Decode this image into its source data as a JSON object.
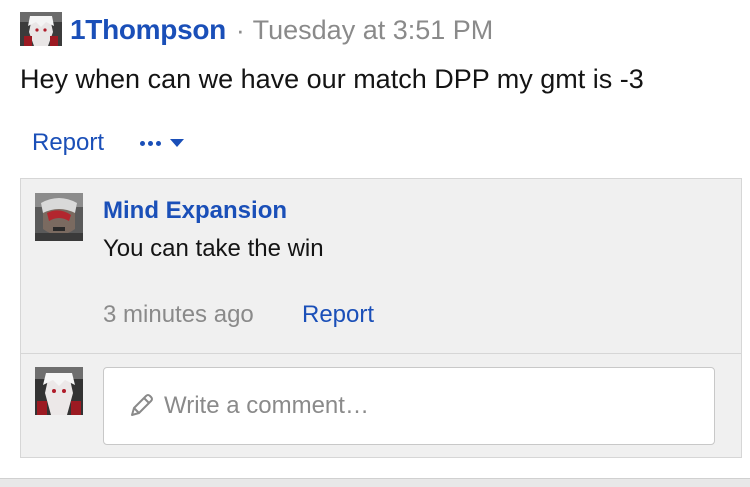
{
  "post": {
    "author": "1Thompson",
    "separator": "·",
    "timestamp": "Tuesday at 3:51 PM",
    "message": "Hey when can we have our match DPP my gmt is -3",
    "report_label": "Report",
    "more_icon": "ellipsis-icon",
    "dropdown_icon": "caret-down-icon"
  },
  "comment": {
    "author": "Mind Expansion",
    "text": "You can take the win",
    "time": "3 minutes ago",
    "report_label": "Report"
  },
  "reply": {
    "placeholder": "Write a comment…",
    "icon": "pencil-icon"
  },
  "colors": {
    "link": "#1a4fb8",
    "muted": "#8a8a8a",
    "panel": "#f0f0f0"
  }
}
